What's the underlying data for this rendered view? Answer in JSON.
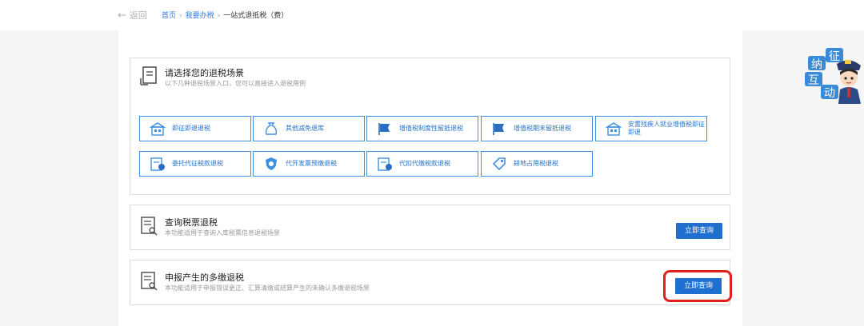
{
  "nav": {
    "back_label": "返回",
    "breadcrumb": [
      "首页",
      "我要办税",
      "一站式退抵税（费）"
    ]
  },
  "scene_card": {
    "title": "请选择您的退税场景",
    "subtitle": "以下几种退税场景入口，您可以直接进入退税用例",
    "buttons": [
      {
        "label": "即征即退退税",
        "icon": "building-icon"
      },
      {
        "label": "其他减免退库",
        "icon": "money-bag-icon"
      },
      {
        "label": "增值税制度性留抵退税",
        "icon": "flag-icon"
      },
      {
        "label": "增值税期末留抵退税",
        "icon": "flag-icon"
      },
      {
        "label": "安置残疾人就业增值税即征即退",
        "icon": "building-icon"
      },
      {
        "label": "委托代征税款退税",
        "icon": "document-refund-icon"
      },
      {
        "label": "代开发票预缴退税",
        "icon": "shield-icon"
      },
      {
        "label": "代扣代缴税款退税",
        "icon": "document-refund-icon"
      },
      {
        "label": "耕地占用税退税",
        "icon": "tag-icon"
      }
    ]
  },
  "query_card": {
    "title": "查询税票退税",
    "subtitle": "本功能适用于查询入库税票信息退税场景",
    "button_label": "立即查询"
  },
  "declare_card": {
    "title": "申报产生的多缴退税",
    "subtitle": "本功能适用于申报错误更正、汇算清缴或结算产生的未确认多缴退税场景",
    "button_label": "立即查询"
  },
  "mascot": {
    "characters": [
      "纳",
      "征",
      "互",
      "动"
    ]
  },
  "colors": {
    "accent": "#1f6fd1",
    "button_border": "#3f8fe0",
    "highlight": "#e0201c"
  }
}
